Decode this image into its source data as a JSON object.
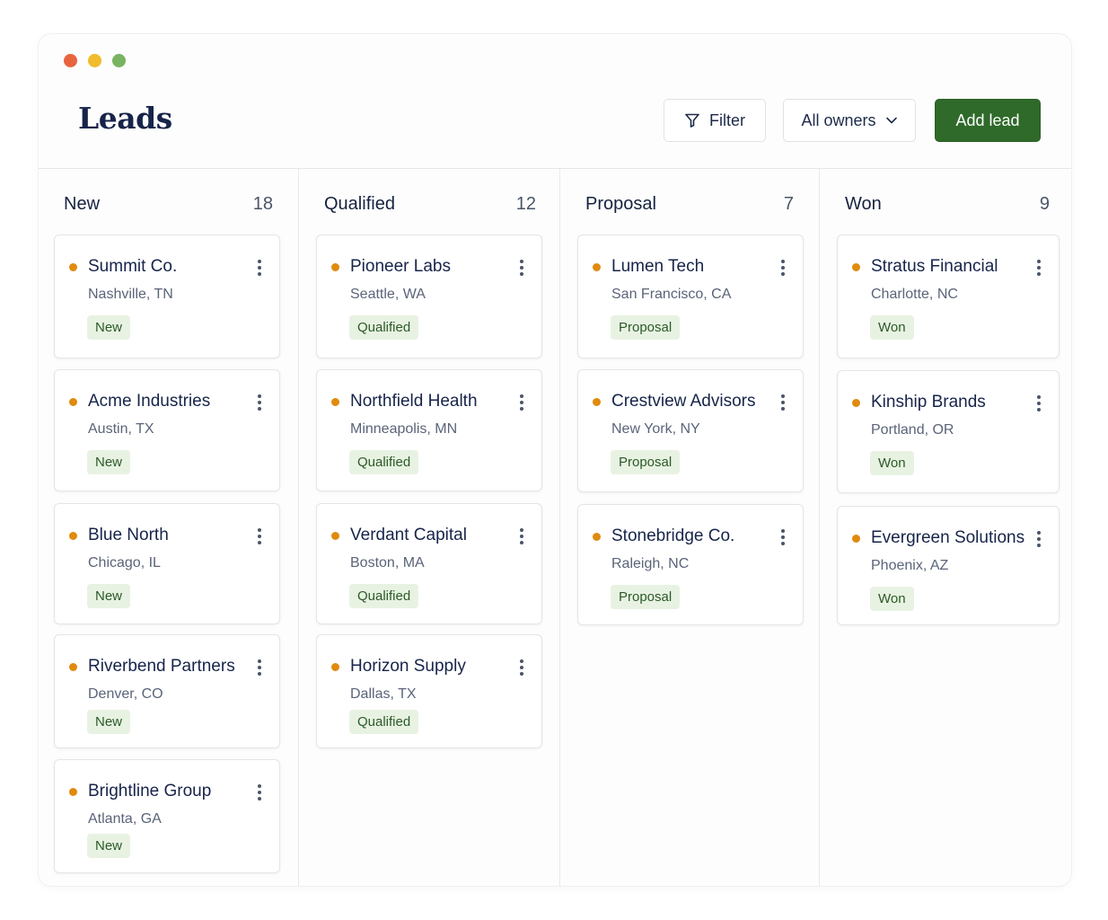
{
  "header": {
    "title": "Leads",
    "filter_label": "Filter",
    "owners_label": "All owners",
    "add_label": "Add lead"
  },
  "colors": {
    "accent": "#2f6a2a",
    "status_dot": "#e08a0e",
    "badge_bg": "#e8f2e2",
    "badge_text": "#2b5a28"
  },
  "icons": {
    "filter": "filter-icon",
    "dropdown": "chevron-down-icon",
    "card_menu": "more-vertical-icon",
    "status": "status-dot-icon"
  },
  "columns": [
    {
      "title": "New",
      "count": "18",
      "cards": [
        {
          "name": "Summit Co.",
          "location": "Nashville, TN",
          "badge": "New"
        },
        {
          "name": "Acme Industries",
          "location": "Austin, TX",
          "badge": "New"
        },
        {
          "name": "Blue North",
          "location": "Chicago, IL",
          "badge": "New"
        },
        {
          "name": "Riverbend Partners",
          "location": "Denver, CO",
          "badge": "New"
        },
        {
          "name": "Brightline Group",
          "location": "Atlanta, GA",
          "badge": "New"
        }
      ]
    },
    {
      "title": "Qualified",
      "count": "12",
      "cards": [
        {
          "name": "Pioneer Labs",
          "location": "Seattle, WA",
          "badge": "Qualified"
        },
        {
          "name": "Northfield Health",
          "location": "Minneapolis, MN",
          "badge": "Qualified"
        },
        {
          "name": "Verdant Capital",
          "location": "Boston, MA",
          "badge": "Qualified"
        },
        {
          "name": "Horizon Supply",
          "location": "Dallas, TX",
          "badge": "Qualified"
        }
      ]
    },
    {
      "title": "Proposal",
      "count": "7",
      "cards": [
        {
          "name": "Lumen Tech",
          "location": "San Francisco, CA",
          "badge": "Proposal"
        },
        {
          "name": "Crestview Advisors",
          "location": "New York, NY",
          "badge": "Proposal"
        },
        {
          "name": "Stonebridge Co.",
          "location": "Raleigh, NC",
          "badge": "Proposal"
        }
      ]
    },
    {
      "title": "Won",
      "count": "9",
      "cards": [
        {
          "name": "Stratus Financial",
          "location": "Charlotte, NC",
          "badge": "Won"
        },
        {
          "name": "Kinship Brands",
          "location": "Portland, OR",
          "badge": "Won"
        },
        {
          "name": "Evergreen Solutions",
          "location": "Phoenix, AZ",
          "badge": "Won"
        }
      ]
    }
  ]
}
